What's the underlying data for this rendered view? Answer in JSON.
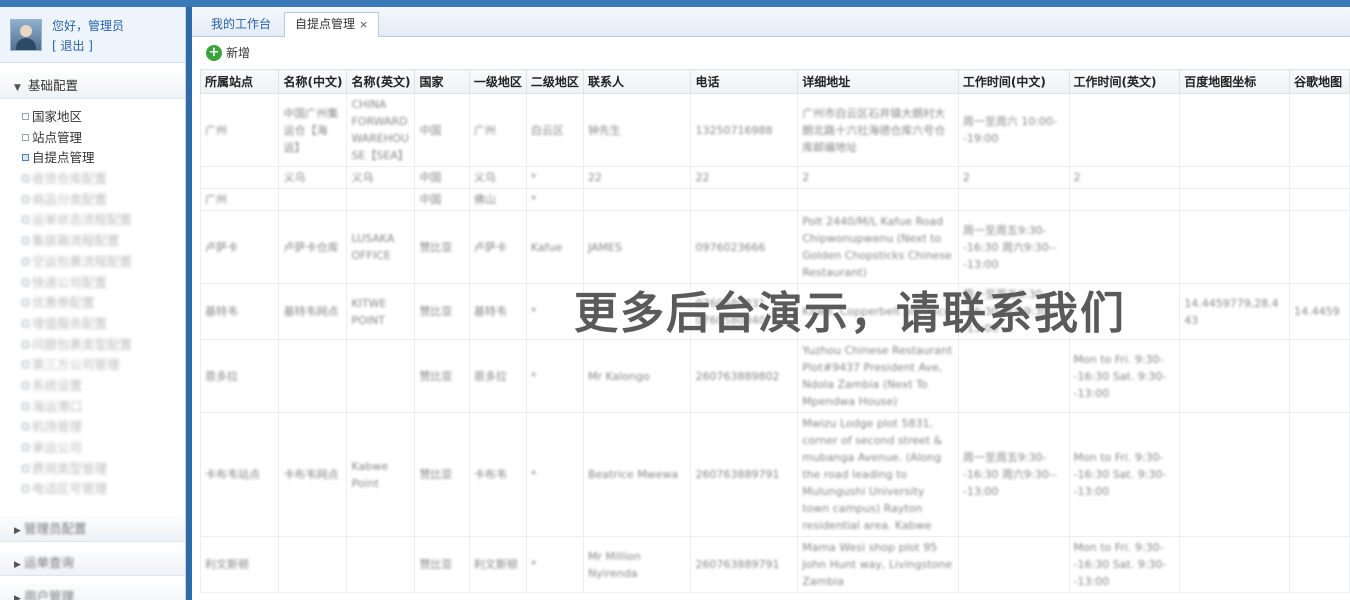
{
  "user": {
    "greeting": "您好，管理员",
    "logout": "[ 退出 ]"
  },
  "sidebar": {
    "section_basic": "基础配置",
    "items": [
      {
        "label": "国家地区",
        "clear": true,
        "active": false
      },
      {
        "label": "站点管理",
        "clear": true,
        "active": false
      },
      {
        "label": "自提点管理",
        "clear": true,
        "active": true
      },
      {
        "label": "收货仓库配置",
        "clear": false
      },
      {
        "label": "商品分类配置",
        "clear": false
      },
      {
        "label": "运单状态流程配置",
        "clear": false
      },
      {
        "label": "集装箱流程配置",
        "clear": false
      },
      {
        "label": "空运包裹流程配置",
        "clear": false
      },
      {
        "label": "快递公司配置",
        "clear": false
      },
      {
        "label": "优惠券配置",
        "clear": false
      },
      {
        "label": "增值服务配置",
        "clear": false
      },
      {
        "label": "问题包裹类型配置",
        "clear": false
      },
      {
        "label": "第三方公司管理",
        "clear": false
      },
      {
        "label": "系统设置",
        "clear": false
      },
      {
        "label": "海运港口",
        "clear": false
      },
      {
        "label": "机场管理",
        "clear": false
      },
      {
        "label": "承运公司",
        "clear": false
      },
      {
        "label": "费用类型管理",
        "clear": false
      },
      {
        "label": "电话区号管理",
        "clear": false
      }
    ],
    "sections_collapsed": [
      "管理员配置",
      "运单查询",
      "用户管理"
    ]
  },
  "tabs": {
    "workspace": "我的工作台",
    "pickup": "自提点管理",
    "close": "×"
  },
  "toolbar": {
    "add_label": "新增"
  },
  "table": {
    "columns": [
      "所属站点",
      "名称(中文)",
      "名称(英文)",
      "国家",
      "一级地区",
      "二级地区",
      "联系人",
      "电话",
      "详细地址",
      "工作时间(中文)",
      "工作时间(英文)",
      "百度地图坐标",
      "谷歌地图"
    ],
    "rows": [
      [
        "广州",
        "中国广州集运仓【海运】",
        "CHINA FORWARD WAREHOUSE【SEA】",
        "中国",
        "广州",
        "白云区",
        "钟先生",
        "13250716988",
        "广州市白云区石井镇大朗村大朗北路十六社海德仓库六号仓库邮编地址",
        "周一至周六 10:00--19:00",
        "",
        "",
        ""
      ],
      [
        "",
        "义乌",
        "义乌",
        "中国",
        "义乌",
        "*",
        "22",
        "22",
        "2",
        "2",
        "2",
        "",
        ""
      ],
      [
        "广州",
        "",
        "",
        "中国",
        "佛山",
        "*",
        "",
        "",
        "",
        "",
        "",
        "",
        ""
      ],
      [
        "卢萨卡",
        "卢萨卡仓库",
        "LUSAKA OFFICE",
        "赞比亚",
        "卢萨卡",
        "Kafue",
        "JAMES",
        "0976023666",
        "Polt 2440/M/L Kafue Road Chipwonupwenu (Next to Golden Chopsticks Chinese Restaurant)",
        "周一至周五9:30--16:30 周六9:30---13:00",
        "",
        "",
        ""
      ],
      [
        "基特韦",
        "基特韦网点",
        "KITWE POINT",
        "赞比亚",
        "基特韦",
        "*",
        "",
        "0760580831 0760580840",
        "Kitwe, Copperbelt province",
        "周一至周五9:30--16:30 周六9:30---13:00",
        "",
        "14.4459779,28.443",
        "14.4459"
      ],
      [
        "恩多拉",
        "",
        "",
        "赞比亚",
        "恩多拉",
        "*",
        "Mr Kalongo",
        "260763889802",
        "Yuzhou Chinese Restaurant Plot#9437 President Ave, Ndola Zambia (Next To Mpendwa House)",
        "",
        "Mon to Fri. 9:30--16:30 Sat. 9:30--13:00",
        "",
        ""
      ],
      [
        "卡布韦站点",
        "卡布韦网点",
        "Kabwe Point",
        "赞比亚",
        "卡布韦",
        "*",
        "Beatrice Mwewa",
        "260763889791",
        "Mwizu Lodge plot 5831, corner of second street & mubanga Avenue. (Along the road leading to Mulungushi University town campus) Rayton residential area. Kabwe",
        "周一至周五9:30--16:30 周六9:30---13:00",
        "Mon to Fri. 9:30--16:30 Sat. 9:30--13:00",
        "",
        ""
      ],
      [
        "利文斯顿",
        "",
        "",
        "赞比亚",
        "利文斯顿",
        "*",
        "Mr Million Nyirenda",
        "260763889791",
        "Mama Wesi shop plot 95 John Hunt way, Livingstone Zambia",
        "",
        "Mon to Fri. 9:30--16:30 Sat. 9:30--13:00",
        "",
        ""
      ]
    ]
  },
  "watermark": "更多后台演示，请联系我们"
}
